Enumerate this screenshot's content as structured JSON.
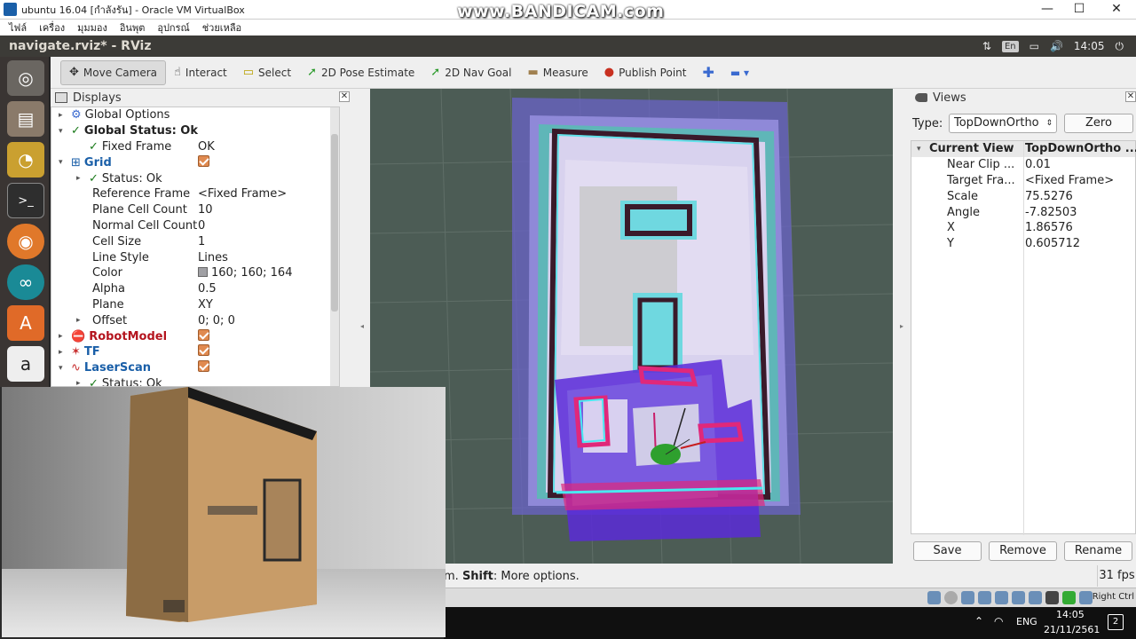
{
  "vbox": {
    "title": "ubuntu 16.04 [กำลังรัน] - Oracle VM VirtualBox",
    "menu": [
      "ไฟล์",
      "เครื่อง",
      "มุมมอง",
      "อินพุต",
      "อุปกรณ์",
      "ช่วยเหลือ"
    ],
    "controls": {
      "minimize": "—",
      "maximize": "☐",
      "close": "✕"
    }
  },
  "watermark": "www.BANDICAM.com",
  "ubuntu": {
    "window_title": "navigate.rviz* - RViz",
    "lang": "En",
    "time": "14:05"
  },
  "launcher": {
    "icons": [
      "ubuntu-dash-icon",
      "files-icon",
      "ros-turtle-icon",
      "terminal-icon",
      "firefox-icon",
      "arduino-icon",
      "software-center-icon",
      "amazon-icon"
    ]
  },
  "toolbar": {
    "tools": [
      {
        "label": "Move Camera",
        "icon": "move-camera-icon",
        "glyph": "✥",
        "active": true
      },
      {
        "label": "Interact",
        "icon": "hand-icon",
        "glyph": "☝"
      },
      {
        "label": "Select",
        "icon": "select-box-icon",
        "glyph": "▭"
      },
      {
        "label": "2D Pose Estimate",
        "icon": "pose-arrow-icon",
        "glyph": "➚"
      },
      {
        "label": "2D Nav Goal",
        "icon": "nav-goal-arrow-icon",
        "glyph": "➚"
      },
      {
        "label": "Measure",
        "icon": "ruler-icon",
        "glyph": "▬"
      },
      {
        "label": "Publish Point",
        "icon": "map-pin-icon",
        "glyph": "●"
      }
    ]
  },
  "displays": {
    "title": "Displays",
    "rows": [
      {
        "indent": 0,
        "arrow": "▸",
        "icon": "gear-blue",
        "key": "Global Options",
        "value": ""
      },
      {
        "indent": 0,
        "arrow": "▾",
        "icon": "check",
        "key": "Global Status: Ok",
        "value": "",
        "bold": true
      },
      {
        "indent": 1,
        "arrow": "",
        "icon": "check",
        "key": "Fixed Frame",
        "value": "OK"
      },
      {
        "indent": 0,
        "arrow": "▾",
        "icon": "grid",
        "key": "Grid",
        "value": "",
        "cb": true,
        "cls": "blue"
      },
      {
        "indent": 1,
        "arrow": "▸",
        "icon": "check",
        "key": "Status: Ok",
        "value": ""
      },
      {
        "indent": 1,
        "arrow": "",
        "icon": "",
        "key": "Reference Frame",
        "value": "<Fixed Frame>"
      },
      {
        "indent": 1,
        "arrow": "",
        "icon": "",
        "key": "Plane Cell Count",
        "value": "10"
      },
      {
        "indent": 1,
        "arrow": "",
        "icon": "",
        "key": "Normal Cell Count",
        "value": "0"
      },
      {
        "indent": 1,
        "arrow": "",
        "icon": "",
        "key": "Cell Size",
        "value": "1"
      },
      {
        "indent": 1,
        "arrow": "",
        "icon": "",
        "key": "Line Style",
        "value": "Lines"
      },
      {
        "indent": 1,
        "arrow": "",
        "icon": "",
        "key": "Color",
        "value": "160; 160; 164",
        "swatch": "#a0a0a4"
      },
      {
        "indent": 1,
        "arrow": "",
        "icon": "",
        "key": "Alpha",
        "value": "0.5"
      },
      {
        "indent": 1,
        "arrow": "",
        "icon": "",
        "key": "Plane",
        "value": "XY"
      },
      {
        "indent": 1,
        "arrow": "▸",
        "icon": "",
        "key": "Offset",
        "value": "0; 0; 0"
      },
      {
        "indent": 0,
        "arrow": "▸",
        "icon": "robot",
        "key": "RobotModel",
        "value": "",
        "cb": true,
        "cls": "red"
      },
      {
        "indent": 0,
        "arrow": "▸",
        "icon": "tf",
        "key": "TF",
        "value": "",
        "cb": true,
        "cls": "blue"
      },
      {
        "indent": 0,
        "arrow": "▾",
        "icon": "laser",
        "key": "LaserScan",
        "value": "",
        "cb": true,
        "cls": "blue"
      },
      {
        "indent": 1,
        "arrow": "▸",
        "icon": "check",
        "key": "Status: Ok",
        "value": ""
      }
    ]
  },
  "views": {
    "title": "Views",
    "type_label": "Type:",
    "type_value": "TopDownOrtho",
    "zero_label": "Zero",
    "rows": [
      {
        "key": "Current View",
        "value": "TopDownOrtho ...",
        "header": true
      },
      {
        "key": "Near Clip ...",
        "value": "0.01"
      },
      {
        "key": "Target Fra...",
        "value": "<Fixed Frame>"
      },
      {
        "key": "Scale",
        "value": "75.5276"
      },
      {
        "key": "Angle",
        "value": "-7.82503"
      },
      {
        "key": "X",
        "value": "1.86576"
      },
      {
        "key": "Y",
        "value": "0.605712"
      }
    ],
    "buttons": {
      "save": "Save",
      "remove": "Remove",
      "rename": "Rename"
    }
  },
  "status": {
    "hint_tail": "m. ",
    "hint_key": "Shift",
    "hint_rest": ": More options.",
    "fps": "31 fps"
  },
  "vbox_status": {
    "host_key": "Right Ctrl"
  },
  "taskbar": {
    "lang": "ENG",
    "time": "14:05",
    "date": "21/11/2561",
    "notify": "2"
  }
}
